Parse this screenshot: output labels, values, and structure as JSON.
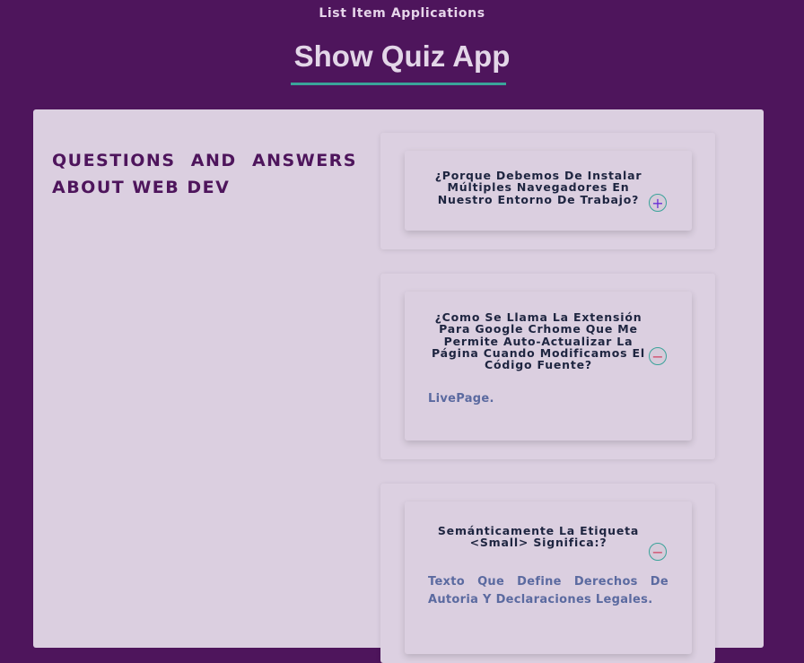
{
  "header": {
    "subtitle": "List Item Applications",
    "title": "Show Quiz App"
  },
  "section": {
    "heading": "QUESTIONS AND ANSWERS ABOUT WEB DEV"
  },
  "questions": [
    {
      "question": "¿Porque Debemos De Instalar Múltiples Navegadores En Nuestro Entorno De Trabajo?",
      "toggle": "+",
      "expanded": false,
      "answer": ""
    },
    {
      "question": "¿Como Se Llama La Extensión Para Google Crhome Que Me Permite Auto-Actualizar La Página Cuando Modificamos El Código Fuente?",
      "toggle": "−",
      "expanded": true,
      "answer": "LivePage."
    },
    {
      "question": "Semánticamente La Etiqueta <Small> Significa:?",
      "toggle": "−",
      "expanded": true,
      "answer": "Texto Que Define Derechos De Autoria Y Declaraciones Legales."
    }
  ],
  "colors": {
    "background": "#4e155c",
    "card": "#dbcfe0",
    "accent": "#3aa39a",
    "question_text": "#1e2540",
    "answer_text": "#5b6aa0",
    "plus_icon": "#6a2fd6",
    "minus_icon": "#d24b6a"
  }
}
